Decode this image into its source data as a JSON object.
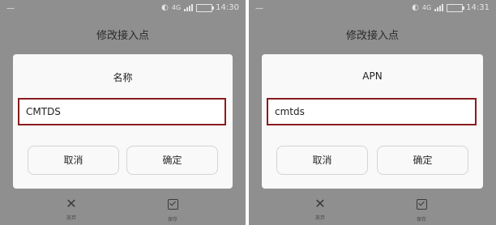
{
  "screens": [
    {
      "status": {
        "network": "4G",
        "time": "14:30"
      },
      "page_title": "修改接入点",
      "dialog": {
        "title": "名称",
        "value": "CMTDS",
        "cancel_label": "取消",
        "confirm_label": "确定"
      },
      "bottom": {
        "cancel_label": "放弃",
        "save_label": "保存"
      }
    },
    {
      "status": {
        "network": "4G",
        "time": "14:31"
      },
      "page_title": "修改接入点",
      "dialog": {
        "title": "APN",
        "value": "cmtds",
        "cancel_label": "取消",
        "confirm_label": "确定"
      },
      "bottom": {
        "cancel_label": "放弃",
        "save_label": "保存"
      }
    }
  ],
  "colors": {
    "overlay": "#8f8f8f",
    "dialog_bg": "#f9f9f9",
    "highlight_border": "#8a1c1c"
  }
}
